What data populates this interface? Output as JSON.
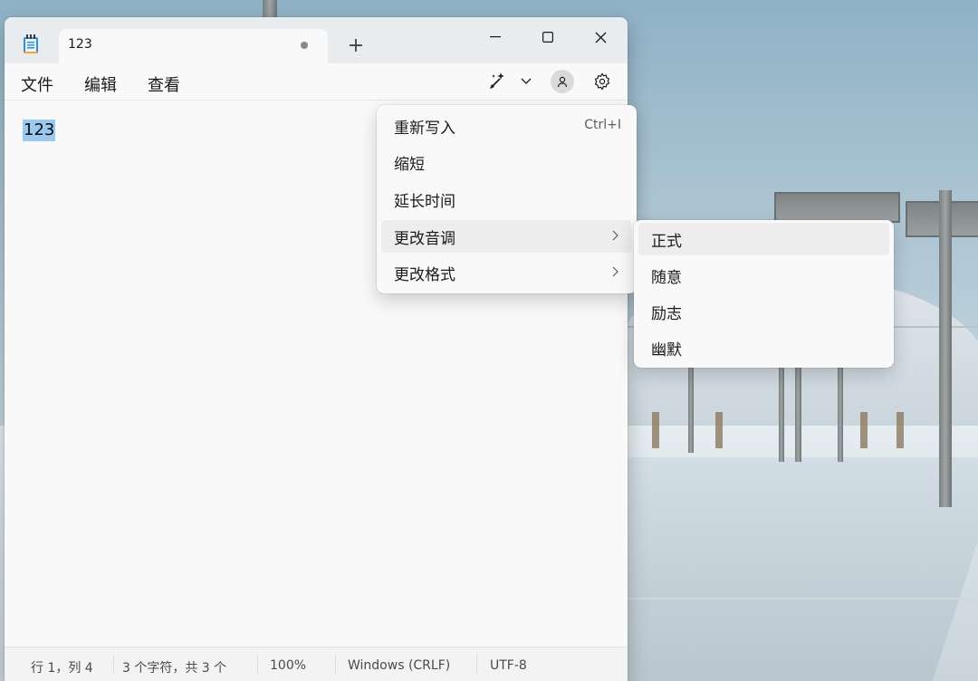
{
  "window": {
    "tab_title": "123",
    "new_tab_glyph": "+",
    "icons": [
      "notepad-icon",
      "unsaved-dot-icon",
      "minimize-icon",
      "maximize-icon",
      "close-icon",
      "copilot-icon",
      "chevron-down-icon",
      "account-icon",
      "gear-icon",
      "chevron-right-icon"
    ]
  },
  "menu": {
    "file": "文件",
    "edit": "编辑",
    "view": "查看"
  },
  "editor": {
    "selected_text": "123"
  },
  "status": {
    "position": "行 1，列 4",
    "chars": "3 个字符，共 3 个",
    "zoom": "100%",
    "line_ending": "Windows (CRLF)",
    "encoding": "UTF-8"
  },
  "rewrite_menu": {
    "items": [
      {
        "label": "重新写入",
        "shortcut": "Ctrl+I"
      },
      {
        "label": "缩短"
      },
      {
        "label": "延长时间"
      },
      {
        "label": "更改音调"
      },
      {
        "label": "更改格式"
      }
    ]
  },
  "tone_submenu": {
    "items": [
      {
        "label": "正式"
      },
      {
        "label": "随意"
      },
      {
        "label": "励志"
      },
      {
        "label": "幽默"
      }
    ]
  },
  "colors": {
    "selection": "#99c9ef",
    "window_bg": "#f9f9f9",
    "titlebar_bg": "#e8ecef"
  }
}
